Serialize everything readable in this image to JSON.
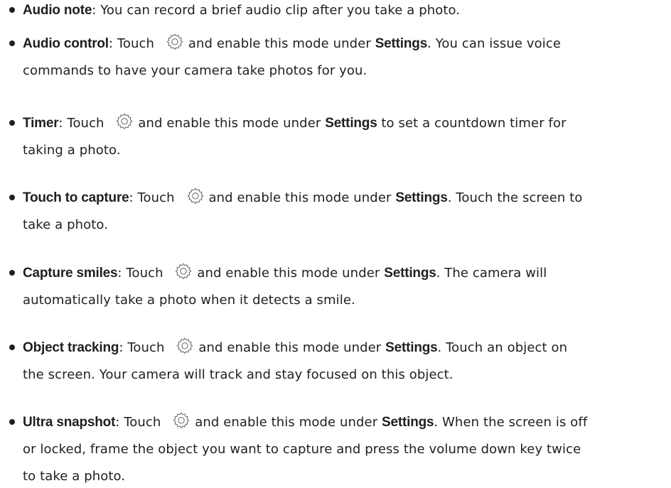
{
  "items": [
    {
      "term": "Audio note",
      "sep": ": ",
      "lines": [
        {
          "before": "You can record a brief audio clip after you take a photo."
        }
      ]
    },
    {
      "term": "Audio control",
      "sep": ": ",
      "touch": "Touch",
      "mid": "and enable this mode under",
      "kw": "Settings",
      "rest": ". You can issue voice",
      "line2": "commands to have your camera take photos for you."
    },
    {
      "term": "Timer",
      "sep": ": ",
      "touch": "Touch",
      "mid": "and enable this mode under",
      "kw": "Settings",
      "rest": " to set a countdown timer for",
      "line2": "taking a photo."
    },
    {
      "term": "Touch to capture",
      "sep": ": ",
      "touch": "Touch",
      "mid": "and enable this mode under",
      "kw": "Settings",
      "rest": ". Touch the screen to",
      "line2": "take a photo."
    },
    {
      "term": "Capture smiles",
      "sep": ": ",
      "touch": "Touch",
      "mid": "and enable this mode under",
      "kw": "Settings",
      "rest": ". The camera will",
      "line2": "automatically take a photo when it detects a smile."
    },
    {
      "term": "Object tracking",
      "sep": ": ",
      "touch": "Touch",
      "mid": "and enable this mode under",
      "kw": "Settings",
      "rest": ". Touch an object on",
      "line2": "the screen. Your camera will track and stay focused on this object."
    },
    {
      "term": "Ultra snapshot",
      "sep": ": ",
      "touch": "Touch",
      "mid": "and enable this mode under",
      "kw": "Settings",
      "rest": ". When the screen is off",
      "line2": "or locked, frame the object you want to capture and press the volume down key twice",
      "line3": "to take a photo."
    }
  ],
  "icons": {
    "settings": "gear-icon"
  },
  "colors": {
    "text": "#1f1f1f",
    "icon_stroke": "#6e6e6e"
  }
}
